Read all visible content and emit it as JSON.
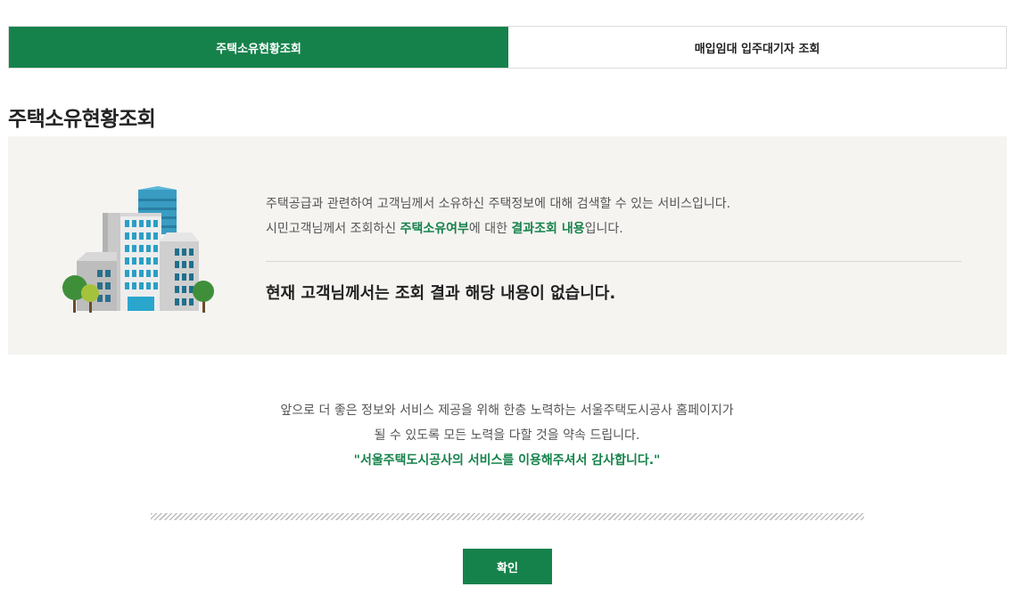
{
  "tabs": [
    {
      "label": "주택소유현황조회",
      "active": true
    },
    {
      "label": "매입임대 입주대기자 조회",
      "active": false
    }
  ],
  "page_title": "주택소유현황조회",
  "info": {
    "line1": "주택공급과 관련하여 고객님께서 소유하신 주택정보에 대해 검색할 수 있는 서비스입니다.",
    "line2_prefix": "시민고객님께서 조회하신 ",
    "line2_em1": "주택소유여부",
    "line2_mid": "에 대한 ",
    "line2_em2": "결과조회 내용",
    "line2_suffix": "입니다.",
    "result": "현재 고객님께서는 조회 결과 해당 내용이 없습니다.",
    "illustration_icon": "building-illustration-icon"
  },
  "footer": {
    "line1": "앞으로 더 좋은 정보와 서비스 제공을 위해 한층 노력하는 서울주택도시공사 홈페이지가",
    "line2": "될 수 있도록 모든 노력을 다할 것을 약속 드립니다.",
    "thanks": "\"서울주택도시공사의 서비스를 이용해주셔서 감사합니다.\""
  },
  "confirm_label": "확인",
  "colors": {
    "accent": "#16824b",
    "box_bg": "#f5f4f1"
  }
}
